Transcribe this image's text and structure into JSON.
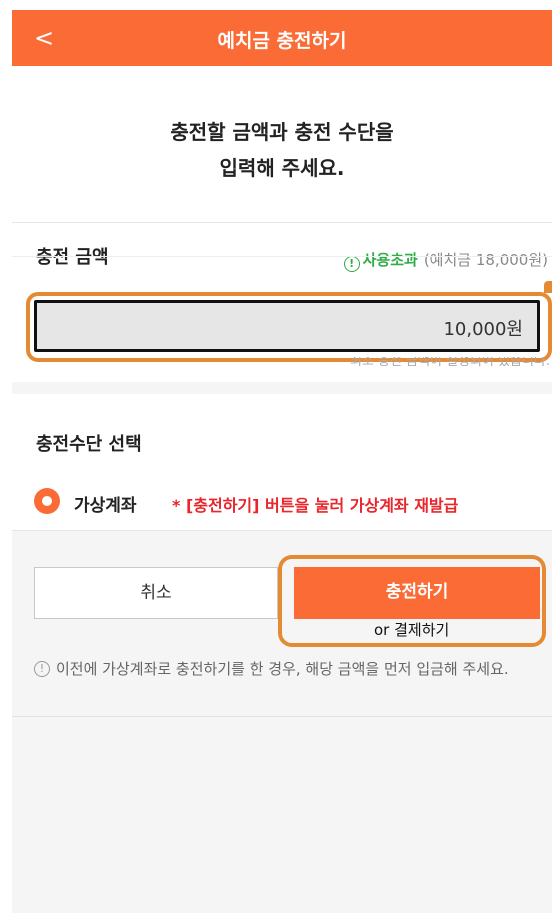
{
  "header": {
    "back_label": "<",
    "title": "예치금 충전하기"
  },
  "intro": {
    "line1": "충전할 금액과 충전 수단을",
    "line2": "입력해 주세요."
  },
  "amount": {
    "label": "충전 금액",
    "over_icon": "!",
    "over_status": "사용초과",
    "balance_note": "(예치금 18,000원)",
    "value": "10,000원",
    "min_note": "최소 충전 금액이 설정되어 있습니다."
  },
  "method": {
    "label": "충전수단 선택",
    "option_label": "가상계좌",
    "option_note": "* [충전하기] 버튼을 눌러 가상계좌 재발급"
  },
  "actions": {
    "cancel_label": "취소",
    "charge_label": "충전하기",
    "alt_label": "or 결제하기"
  },
  "info": {
    "icon": "!",
    "text": "이전에 가상계좌로 충전하기를 한 경우, 해당 금액을 먼저 입금해 주세요."
  },
  "colors": {
    "brand": "#fa6b35",
    "status_ok": "#2eac46",
    "alert": "#e8262b",
    "annotation": "#e58a34"
  }
}
